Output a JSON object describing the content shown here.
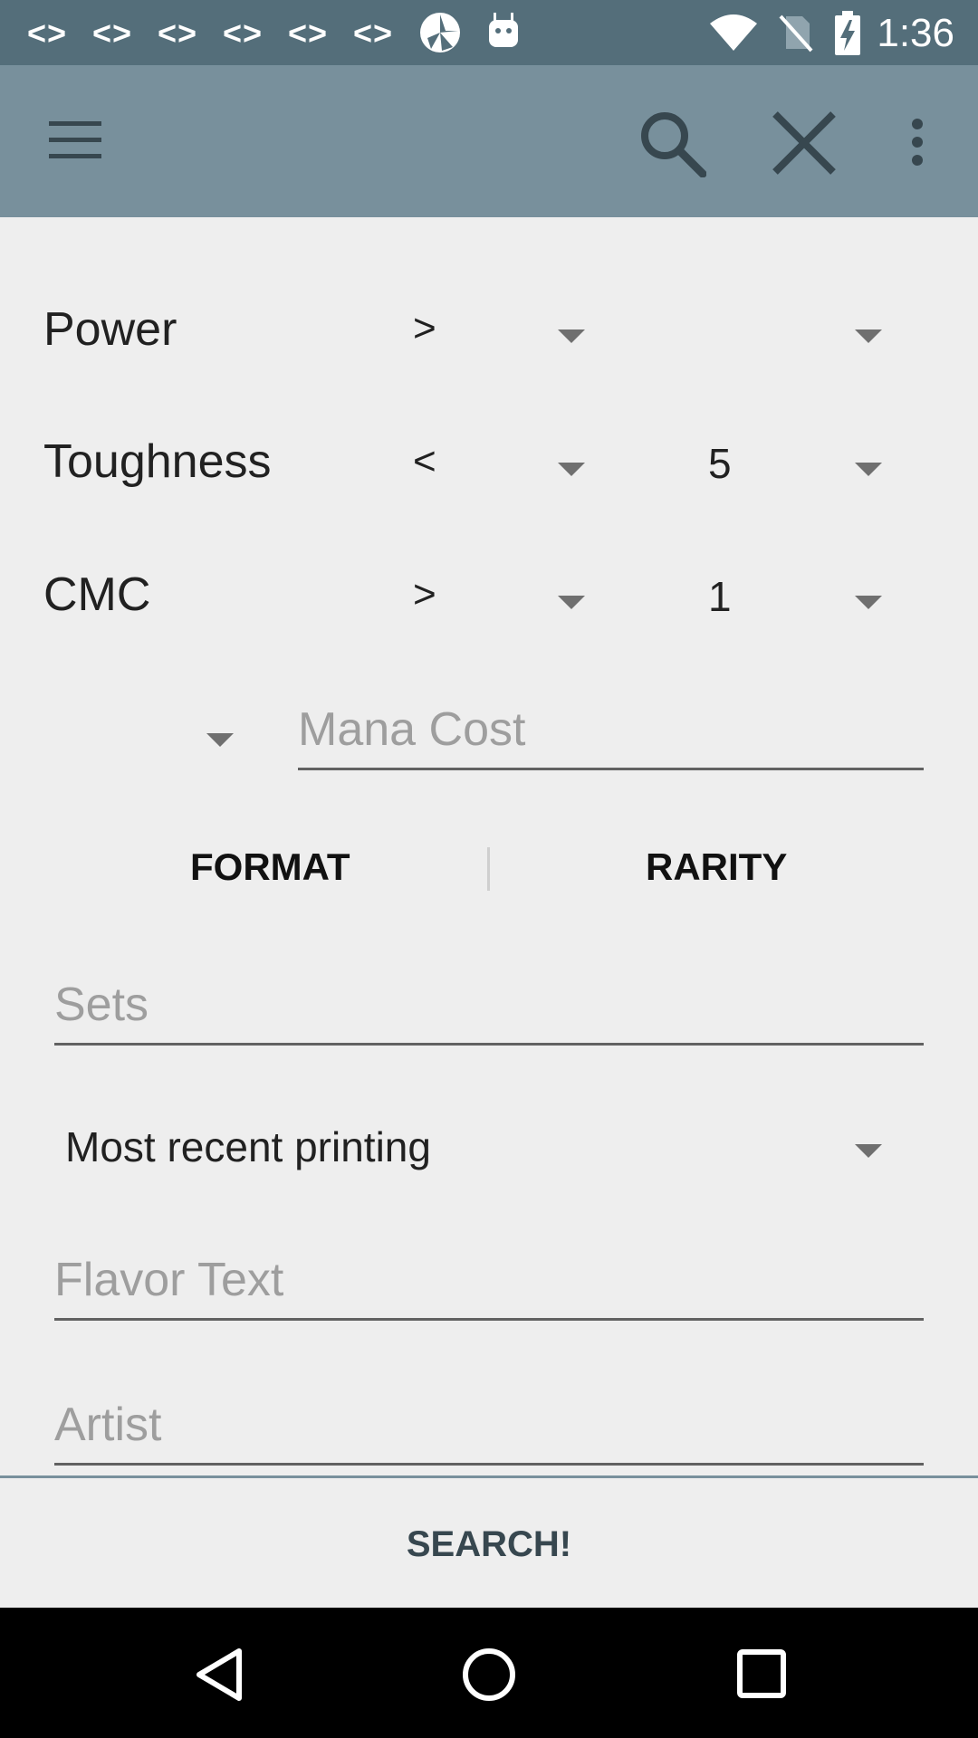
{
  "status_bar": {
    "notifications": [
      "<>",
      "<>",
      "<>",
      "<>",
      "<>",
      "<>"
    ],
    "time": "1:36"
  },
  "toolbar": {
    "menu_icon": "hamburger-menu-icon",
    "search_icon": "search-icon",
    "close_icon": "close-icon",
    "overflow_icon": "more-vert-icon"
  },
  "filters": {
    "power": {
      "label": "Power",
      "operator": ">",
      "value": ""
    },
    "toughness": {
      "label": "Toughness",
      "operator": "<",
      "value": "5"
    },
    "cmc": {
      "label": "CMC",
      "operator": ">",
      "value": "1"
    }
  },
  "mana_cost": {
    "placeholder": "Mana Cost"
  },
  "buttons": {
    "format": "FORMAT",
    "rarity": "RARITY",
    "search": "SEARCH!"
  },
  "sets": {
    "placeholder": "Sets"
  },
  "printing": {
    "selected": "Most recent printing"
  },
  "flavor_text": {
    "placeholder": "Flavor Text"
  },
  "artist": {
    "placeholder": "Artist"
  },
  "colors": {
    "status_bar": "#546e7a",
    "toolbar": "#78909c",
    "background": "#eeeeee"
  }
}
